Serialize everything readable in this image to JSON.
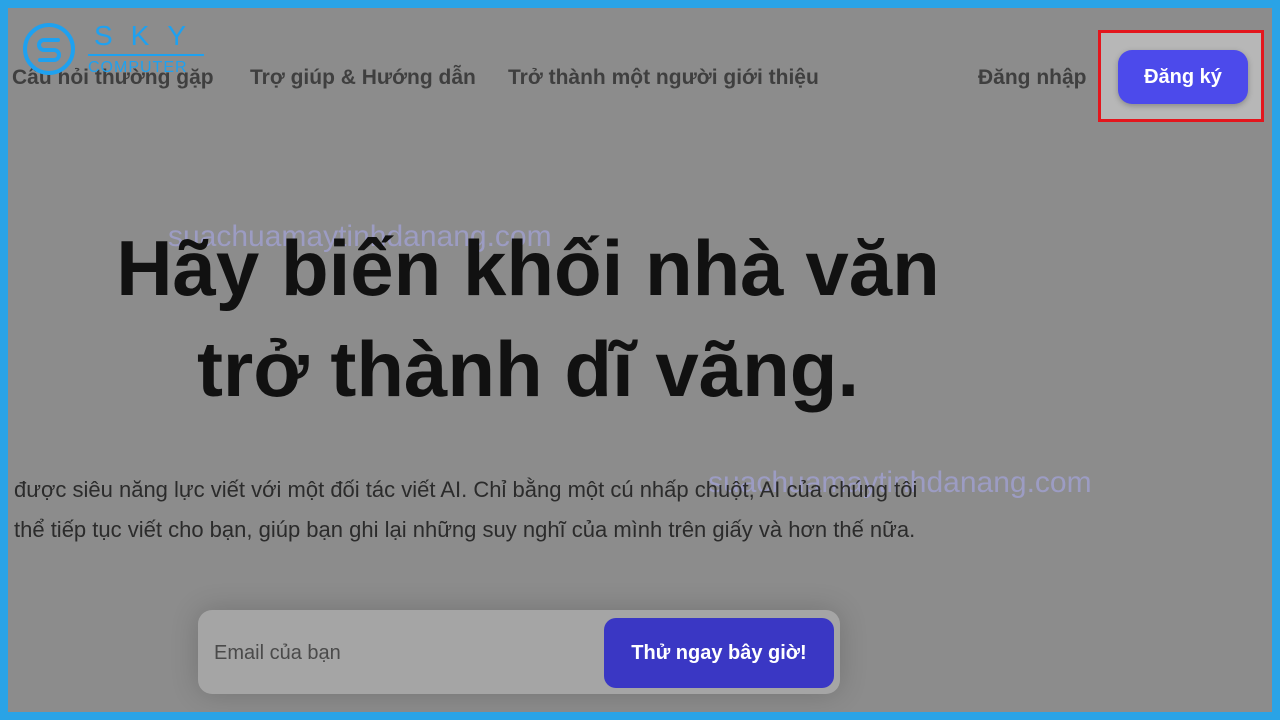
{
  "logo": {
    "top_text": "SKY",
    "bottom_text": "COMPUTER"
  },
  "nav": {
    "links": [
      "Câu hỏi thường gặp",
      "Trợ giúp & Hướng dẫn",
      "Trở thành một người giới thiệu"
    ],
    "login_label": "Đăng nhập",
    "signup_label": "Đăng ký"
  },
  "hero": {
    "title_line1": "Hãy biến khối nhà văn",
    "title_line2": "trở thành dĩ vãng.",
    "desc_line1": "được siêu năng lực viết với một đối tác viết AI. Chỉ bằng một cú nhấp chuột, AI của chúng tôi",
    "desc_line2": "thể tiếp tục viết cho bạn, giúp bạn ghi lại những suy nghĩ của mình trên giấy và hơn thế nữa."
  },
  "watermarks": {
    "w1": "suachuamaytinhdanang.com",
    "w2": "suachuamaytinhdanang.com"
  },
  "form": {
    "email_placeholder": "Email của bạn",
    "try_label": "Thử ngay bây giờ!"
  },
  "colors": {
    "border": "#2aa3e6",
    "overlay": "#8c8c8c",
    "primary_button": "#4c4aeb",
    "try_button": "#3a37c4",
    "highlight_box": "#e3161d",
    "logo": "#1ea1f0"
  }
}
